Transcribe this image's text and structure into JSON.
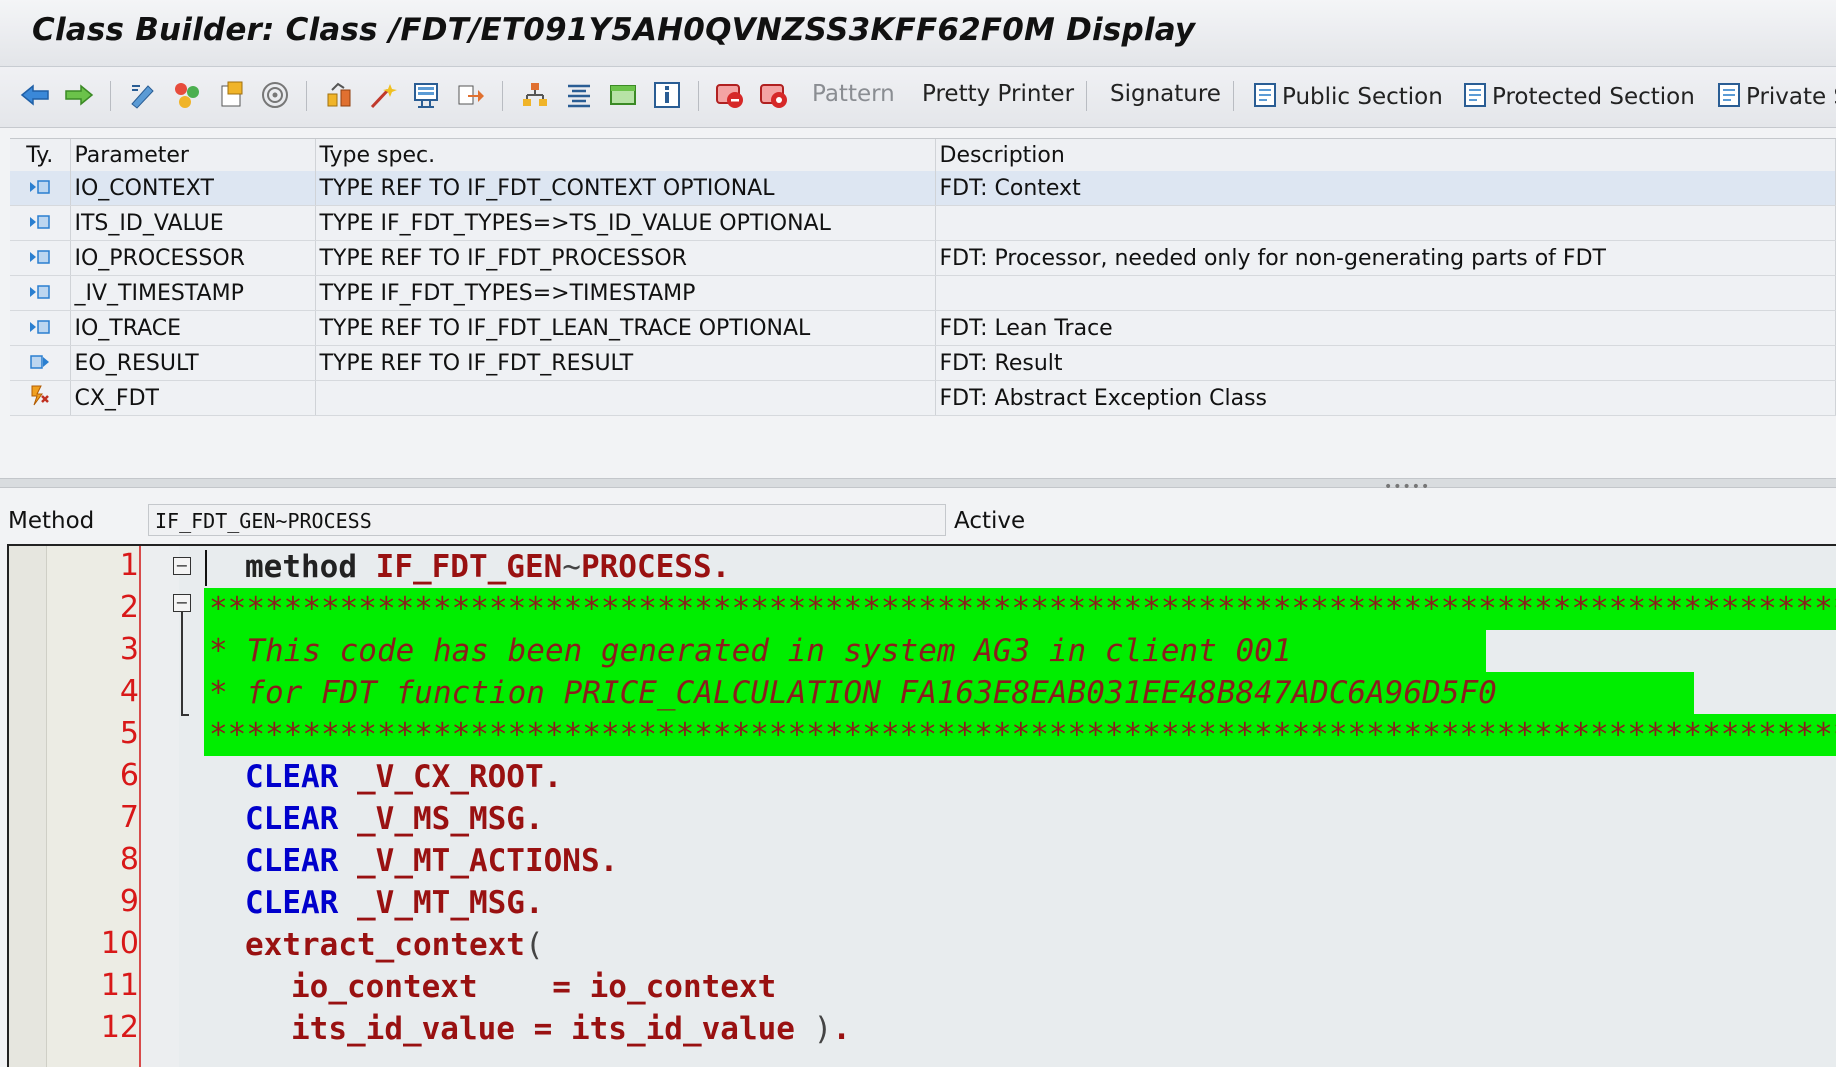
{
  "window": {
    "title": "Class Builder: Class /FDT/ET091Y5AH0QVNZSS3KFF62F0M Display"
  },
  "toolbar": {
    "icons": [
      "back-arrow-icon",
      "forward-arrow-icon",
      "display-change-icon",
      "active-inactive-icon",
      "other-object-icon",
      "where-used-icon",
      "check-icon",
      "activate-icon",
      "test-icon",
      "navigate-icon",
      "hierarchy-icon",
      "outline-icon",
      "fullscreen-icon",
      "info-icon",
      "set-breakpoint-icon",
      "session-breakpoint-icon"
    ],
    "pattern_label": "Pattern",
    "pretty_printer_label": "Pretty Printer",
    "signature_label": "Signature",
    "public_section_label": "Public Section",
    "protected_section_label": "Protected Section",
    "private_section_label": "Private S"
  },
  "params": {
    "headers": {
      "ty": "Ty.",
      "parameter": "Parameter",
      "type_spec": "Type spec.",
      "description": "Description"
    },
    "rows": [
      {
        "kind": "importing",
        "name": "IO_CONTEXT",
        "type": "TYPE REF TO IF_FDT_CONTEXT OPTIONAL",
        "desc": "FDT: Context"
      },
      {
        "kind": "importing",
        "name": "ITS_ID_VALUE",
        "type": "TYPE IF_FDT_TYPES=>TS_ID_VALUE OPTIONAL",
        "desc": ""
      },
      {
        "kind": "importing",
        "name": "IO_PROCESSOR",
        "type": "TYPE REF TO IF_FDT_PROCESSOR",
        "desc": "FDT: Processor, needed only for non-generating parts of FDT"
      },
      {
        "kind": "importing",
        "name": "_IV_TIMESTAMP",
        "type": "TYPE IF_FDT_TYPES=>TIMESTAMP",
        "desc": ""
      },
      {
        "kind": "importing",
        "name": "IO_TRACE",
        "type": "TYPE REF TO IF_FDT_LEAN_TRACE OPTIONAL",
        "desc": "FDT: Lean Trace"
      },
      {
        "kind": "exporting",
        "name": "EO_RESULT",
        "type": "TYPE REF TO IF_FDT_RESULT",
        "desc": "FDT: Result"
      },
      {
        "kind": "exception",
        "name": "CX_FDT",
        "type": "",
        "desc": "FDT: Abstract Exception Class"
      }
    ]
  },
  "method": {
    "label": "Method",
    "value": "IF_FDT_GEN~PROCESS",
    "status": "Active"
  },
  "editor": {
    "lines": [
      {
        "n": "1"
      },
      {
        "n": "2",
        "text": "****************************************************************************************"
      },
      {
        "n": "3",
        "text": "* This code has been generated in system AG3 in client 001"
      },
      {
        "n": "4",
        "text": "* for FDT function PRICE_CALCULATION FA163E8EAB031EE48B847ADC6A96D5F0"
      },
      {
        "n": "5",
        "text": "****************************************************************************************"
      },
      {
        "n": "6"
      },
      {
        "n": "7"
      },
      {
        "n": "8"
      },
      {
        "n": "9"
      },
      {
        "n": "10"
      },
      {
        "n": "11"
      },
      {
        "n": "12"
      }
    ],
    "tokens": {
      "method_kw": "method",
      "method_name_a": "IF_FDT_GEN",
      "tilde": "~",
      "method_name_b": "PROCESS",
      "dot": ".",
      "clear_kw": "CLEAR",
      "v_cx_root": "_V_CX_ROOT",
      "v_ms_msg": "_V_MS_MSG",
      "v_mt_actions": "_V_MT_ACTIONS",
      "v_mt_msg": "_V_MT_MSG",
      "extract_context": "extract_context",
      "paren_open": "(",
      "io_context": "io_context",
      "eq": "=",
      "its_id_value": "its_id_value",
      "paren_close": ")",
      "end_dot": "."
    },
    "colors": {
      "keyword": "#0000cc",
      "identifier": "#991111",
      "comment_bg": "#00ee00",
      "line_number": "#d81818"
    }
  }
}
